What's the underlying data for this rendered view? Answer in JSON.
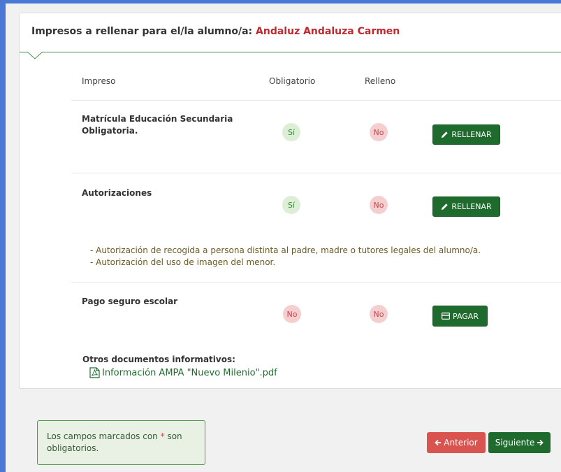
{
  "header": {
    "title_prefix": "Impresos a rellenar para el/la alumno/a:",
    "student_name": "Andaluz Andaluza Carmen"
  },
  "table": {
    "columns": [
      "Impreso",
      "Obligatorio",
      "Relleno"
    ],
    "rows": [
      {
        "title_line1": "Matrícula Educación Secundaria",
        "title_line2": "Obligatoria.",
        "obligatorio": "Sí",
        "relleno": "No",
        "action": "RELLENAR"
      },
      {
        "title_line1": "Autorizaciones",
        "obligatorio": "Sí",
        "relleno": "No",
        "action": "RELLENAR",
        "notes": [
          "- Autorización de recogida a persona distinta al padre, madre o tutores legales del alumno/a.",
          "- Autorización del uso de imagen del menor."
        ]
      },
      {
        "title_line1": "Pago seguro escolar",
        "obligatorio": "No",
        "relleno": "No",
        "action": "PAGAR"
      }
    ]
  },
  "otros": {
    "title": "Otros documentos informativos:",
    "link": "Información AMPA \"Nuevo Milenio\".pdf"
  },
  "info": {
    "text_before": "Los campos marcados con",
    "star": "*",
    "text_after": "son obligatorios."
  },
  "nav": {
    "prev": "Anterior",
    "next": "Siguiente"
  },
  "colors": {
    "accent_green": "#1f6b2e",
    "danger_red": "#d9534f",
    "student_red": "#c0282f",
    "frame_blue": "#4a78d4"
  }
}
